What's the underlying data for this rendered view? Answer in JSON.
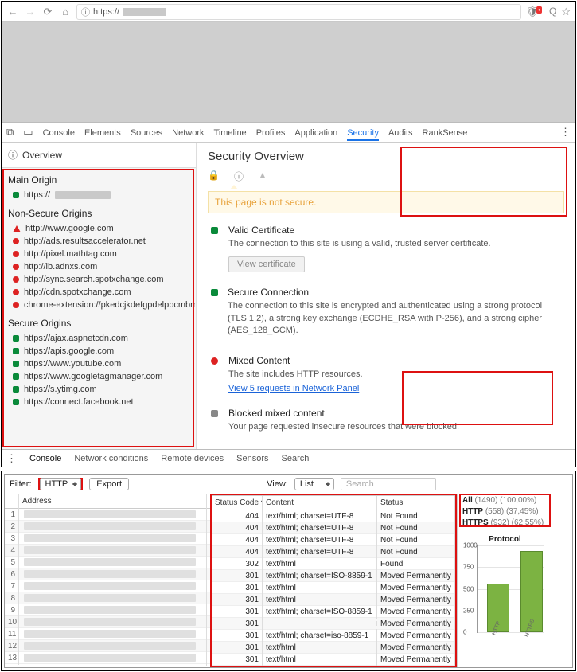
{
  "address_bar": {
    "scheme": "https://",
    "info_icon": "ⓘ"
  },
  "devtools": {
    "tabs": [
      "Console",
      "Elements",
      "Sources",
      "Network",
      "Timeline",
      "Profiles",
      "Application",
      "Security",
      "Audits",
      "RankSense"
    ],
    "active_tab": "Security",
    "overview_label": "Overview",
    "drawer_tabs": [
      "Console",
      "Network conditions",
      "Remote devices",
      "Sensors",
      "Search"
    ]
  },
  "origins": {
    "main_h": "Main Origin",
    "main": [
      {
        "mk": "sq-green",
        "label": "https://",
        "redact": true
      }
    ],
    "ns_h": "Non-Secure Origins",
    "ns": [
      {
        "mk": "tri-red",
        "label": "http://www.google.com"
      },
      {
        "mk": "sq-red",
        "label": "http://ads.resultsaccelerator.net"
      },
      {
        "mk": "sq-red",
        "label": "http://pixel.mathtag.com"
      },
      {
        "mk": "sq-red",
        "label": "http://ib.adnxs.com"
      },
      {
        "mk": "sq-red",
        "label": "http://sync.search.spotxchange.com"
      },
      {
        "mk": "sq-red",
        "label": "http://cdn.spotxchange.com"
      },
      {
        "mk": "sq-red",
        "label": "chrome-extension://pkedcjkdefgpdelpbcmbme"
      }
    ],
    "sec_h": "Secure Origins",
    "sec": [
      {
        "mk": "sq-green",
        "label": "https://ajax.aspnetcdn.com"
      },
      {
        "mk": "sq-green",
        "label": "https://apis.google.com"
      },
      {
        "mk": "sq-green",
        "label": "https://www.youtube.com"
      },
      {
        "mk": "sq-green",
        "label": "https://www.googletagmanager.com"
      },
      {
        "mk": "sq-green",
        "label": "https://s.ytimg.com"
      },
      {
        "mk": "sq-green",
        "label": "https://connect.facebook.net"
      }
    ]
  },
  "security": {
    "title": "Security Overview",
    "not_secure": "This page is not secure.",
    "blocks": [
      {
        "mk": "#0a8a3a",
        "h": "Valid Certificate",
        "p": "The connection to this site is using a valid, trusted server certificate.",
        "btn": "View certificate"
      },
      {
        "mk": "#0a8a3a",
        "h": "Secure Connection",
        "p": "The connection to this site is encrypted and authenticated using a strong protocol (TLS 1.2), a strong key exchange (ECDHE_RSA with P-256), and a strong cipher (AES_128_GCM)."
      },
      {
        "mk": "#d22",
        "round": true,
        "h": "Mixed Content",
        "p": "The site includes HTTP resources.",
        "link": "View 5 requests in Network Panel"
      },
      {
        "mk": "#888",
        "h": "Blocked mixed content",
        "p": "Your page requested insecure resources that were blocked."
      }
    ]
  },
  "panel2": {
    "filter_label": "Filter:",
    "filter_value": "HTTP",
    "export_label": "Export",
    "view_label": "View:",
    "view_value": "List",
    "search_placeholder": "Search",
    "headers": [
      "",
      "Address",
      "Status Code ▾",
      "Content",
      "Status"
    ],
    "rows": [
      {
        "n": 1,
        "code": 404,
        "ct": "text/html; charset=UTF-8",
        "st": "Not Found"
      },
      {
        "n": 2,
        "code": 404,
        "ct": "text/html; charset=UTF-8",
        "st": "Not Found"
      },
      {
        "n": 3,
        "code": 404,
        "ct": "text/html; charset=UTF-8",
        "st": "Not Found"
      },
      {
        "n": 4,
        "code": 404,
        "ct": "text/html; charset=UTF-8",
        "st": "Not Found"
      },
      {
        "n": 5,
        "code": 302,
        "ct": "text/html",
        "st": "Found"
      },
      {
        "n": 6,
        "code": 301,
        "ct": "text/html; charset=ISO-8859-1",
        "st": "Moved Permanently"
      },
      {
        "n": 7,
        "code": 301,
        "ct": "text/html",
        "st": "Moved Permanently"
      },
      {
        "n": 8,
        "code": 301,
        "ct": "text/html",
        "st": "Moved Permanently"
      },
      {
        "n": 9,
        "code": 301,
        "ct": "text/html; charset=ISO-8859-1",
        "st": "Moved Permanently"
      },
      {
        "n": 10,
        "code": 301,
        "ct": "",
        "st": "Moved Permanently"
      },
      {
        "n": 11,
        "code": 301,
        "ct": "text/html; charset=iso-8859-1",
        "st": "Moved Permanently"
      },
      {
        "n": 12,
        "code": 301,
        "ct": "text/html",
        "st": "Moved Permanently"
      },
      {
        "n": 13,
        "code": 301,
        "ct": "text/html",
        "st": "Moved Permanently"
      }
    ],
    "stats": [
      {
        "k": "All",
        "v": "(1490) (100,00%)"
      },
      {
        "k": "HTTP",
        "v": "(558) (37,45%)"
      },
      {
        "k": "HTTPS",
        "v": "(932) (62,55%)"
      }
    ]
  },
  "chart_data": {
    "type": "bar",
    "title": "Protocol",
    "categories": [
      "HTTP",
      "HTTPS"
    ],
    "values": [
      558,
      932
    ],
    "ylim": [
      0,
      1000
    ],
    "yticks": [
      0,
      250,
      500,
      750,
      1000
    ]
  }
}
